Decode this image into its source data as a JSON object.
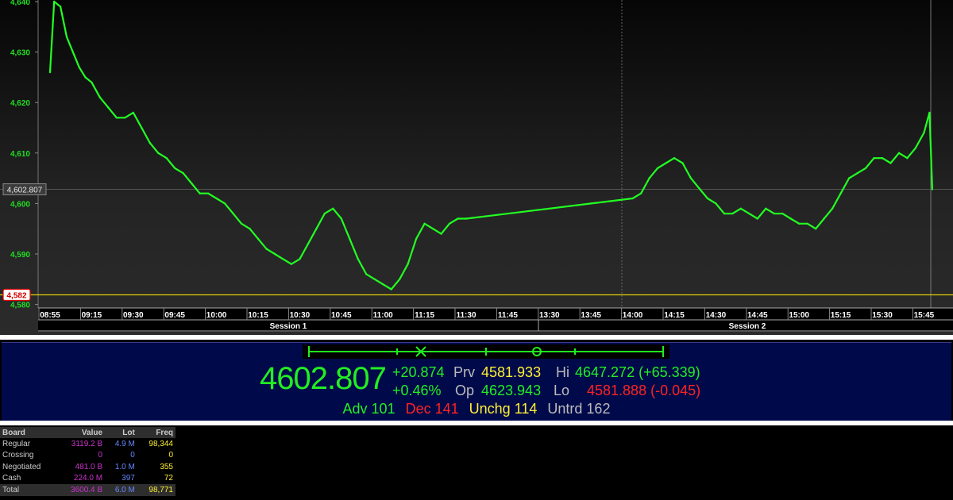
{
  "chart_data": {
    "type": "line",
    "x_tick_labels": [
      "08:55",
      "09:15",
      "09:30",
      "09:45",
      "10:00",
      "10:15",
      "10:30",
      "10:45",
      "11:00",
      "11:15",
      "11:30",
      "11:45",
      "13:30",
      "13:45",
      "14:00",
      "14:15",
      "14:30",
      "14:45",
      "15:00",
      "15:15",
      "15:30",
      "15:45"
    ],
    "y_tick_labels": [
      "4,640",
      "4,630",
      "4,620",
      "4,610",
      "4,600",
      "4,590",
      "4,580"
    ],
    "ylim": [
      4580,
      4640
    ],
    "sessions": [
      "Session 1",
      "Session 2"
    ],
    "current_value_label": "4,602.807",
    "current_value": 4602.807,
    "reference_label": "4,582",
    "reference_value": 4581.9,
    "series": [
      {
        "color": "#22ff22",
        "points": [
          [
            "08:55",
            4626.0
          ],
          [
            "08:57",
            4640.0
          ],
          [
            "09:00",
            4639.0
          ],
          [
            "09:03",
            4633.0
          ],
          [
            "09:06",
            4630.0
          ],
          [
            "09:09",
            4627.0
          ],
          [
            "09:12",
            4625.0
          ],
          [
            "09:15",
            4624.0
          ],
          [
            "09:18",
            4621.0
          ],
          [
            "09:21",
            4619.0
          ],
          [
            "09:24",
            4617.0
          ],
          [
            "09:27",
            4617.0
          ],
          [
            "09:30",
            4618.0
          ],
          [
            "09:33",
            4615.0
          ],
          [
            "09:36",
            4612.0
          ],
          [
            "09:39",
            4610.0
          ],
          [
            "09:42",
            4609.0
          ],
          [
            "09:45",
            4607.0
          ],
          [
            "09:48",
            4606.0
          ],
          [
            "09:51",
            4604.0
          ],
          [
            "09:54",
            4602.0
          ],
          [
            "09:57",
            4602.0
          ],
          [
            "10:00",
            4601.0
          ],
          [
            "10:03",
            4600.0
          ],
          [
            "10:06",
            4598.0
          ],
          [
            "10:09",
            4596.0
          ],
          [
            "10:12",
            4595.0
          ],
          [
            "10:15",
            4593.0
          ],
          [
            "10:18",
            4591.0
          ],
          [
            "10:21",
            4590.0
          ],
          [
            "10:24",
            4589.0
          ],
          [
            "10:27",
            4588.0
          ],
          [
            "10:30",
            4589.0
          ],
          [
            "10:33",
            4592.0
          ],
          [
            "10:36",
            4595.0
          ],
          [
            "10:39",
            4598.0
          ],
          [
            "10:42",
            4599.0
          ],
          [
            "10:45",
            4597.0
          ],
          [
            "10:48",
            4593.0
          ],
          [
            "10:51",
            4589.0
          ],
          [
            "10:54",
            4586.0
          ],
          [
            "10:57",
            4585.0
          ],
          [
            "11:00",
            4584.0
          ],
          [
            "11:03",
            4583.0
          ],
          [
            "11:06",
            4585.0
          ],
          [
            "11:09",
            4588.0
          ],
          [
            "11:12",
            4593.0
          ],
          [
            "11:15",
            4596.0
          ],
          [
            "11:18",
            4595.0
          ],
          [
            "11:21",
            4594.0
          ],
          [
            "11:24",
            4596.0
          ],
          [
            "11:27",
            4597.0
          ],
          [
            "11:30",
            4597.0
          ],
          [
            "13:30",
            4599.0
          ],
          [
            "13:45",
            4600.0
          ],
          [
            "14:00",
            4601.0
          ],
          [
            "14:03",
            4602.0
          ],
          [
            "14:06",
            4605.0
          ],
          [
            "14:09",
            4607.0
          ],
          [
            "14:12",
            4608.0
          ],
          [
            "14:15",
            4609.0
          ],
          [
            "14:18",
            4608.0
          ],
          [
            "14:21",
            4605.0
          ],
          [
            "14:24",
            4603.0
          ],
          [
            "14:27",
            4601.0
          ],
          [
            "14:30",
            4600.0
          ],
          [
            "14:33",
            4598.0
          ],
          [
            "14:36",
            4598.0
          ],
          [
            "14:39",
            4599.0
          ],
          [
            "14:42",
            4598.0
          ],
          [
            "14:45",
            4597.0
          ],
          [
            "14:48",
            4599.0
          ],
          [
            "14:51",
            4598.0
          ],
          [
            "14:54",
            4598.0
          ],
          [
            "14:57",
            4597.0
          ],
          [
            "15:00",
            4596.0
          ],
          [
            "15:03",
            4596.0
          ],
          [
            "15:06",
            4595.0
          ],
          [
            "15:09",
            4597.0
          ],
          [
            "15:12",
            4599.0
          ],
          [
            "15:15",
            4602.0
          ],
          [
            "15:18",
            4605.0
          ],
          [
            "15:21",
            4606.0
          ],
          [
            "15:24",
            4607.0
          ],
          [
            "15:27",
            4609.0
          ],
          [
            "15:30",
            4609.0
          ],
          [
            "15:33",
            4608.0
          ],
          [
            "15:36",
            4610.0
          ],
          [
            "15:39",
            4609.0
          ],
          [
            "15:42",
            4611.0
          ],
          [
            "15:45",
            4614.0
          ],
          [
            "15:47",
            4618.0
          ],
          [
            "15:48",
            4602.807
          ]
        ]
      }
    ]
  },
  "quote": {
    "last": "4602.807",
    "change": "+20.874",
    "change_pct": "+0.46%",
    "prv_label": "Prv",
    "prv": "4581.933",
    "op_label": "Op",
    "op": "4623.943",
    "hi_label": "Hi",
    "hi": "4647.272 (+65.339)",
    "lo_label": "Lo",
    "lo": "4581.888 (-0.045)"
  },
  "breadth": {
    "adv": "Adv 101",
    "dec": "Dec 141",
    "unchg": "Unchg 114",
    "untrd": "Untrd 162"
  },
  "board": {
    "headers": [
      "Board",
      "Value",
      "Lot",
      "Freq"
    ],
    "rows": [
      {
        "board": "Regular",
        "value": "3119.2 B",
        "lot": "4.9 M",
        "freq": "98,344"
      },
      {
        "board": "Crossing",
        "value": "0",
        "lot": "0",
        "freq": "0"
      },
      {
        "board": "Negotiated",
        "value": "481.0 B",
        "lot": "1.0 M",
        "freq": "355"
      },
      {
        "board": "Cash",
        "value": "224.0 M",
        "lot": "397",
        "freq": "72"
      },
      {
        "board": "Total",
        "value": "3600.4 B",
        "lot": "6.0 M",
        "freq": "98,771"
      }
    ]
  }
}
